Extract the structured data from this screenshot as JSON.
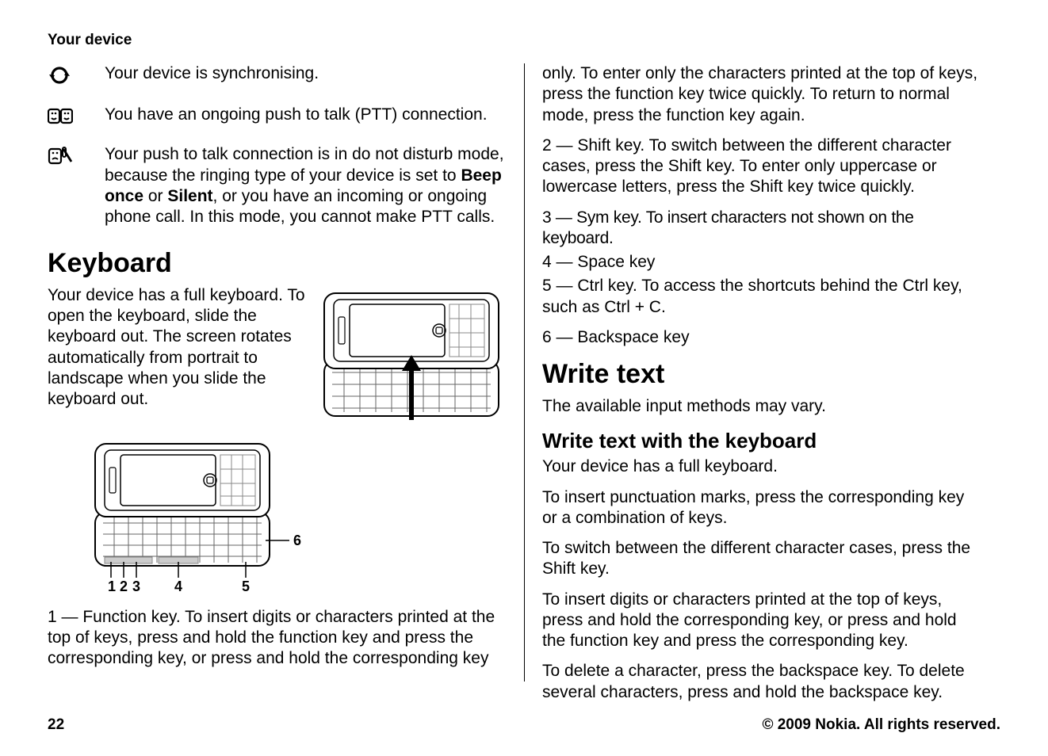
{
  "header": "Your device",
  "icons": [
    {
      "name": "sync-icon",
      "text_key": "icons.0.text",
      "text": "Your device is synchronising."
    },
    {
      "name": "ptt-ongoing-icon",
      "text_key": "icons.1.text",
      "text": "You have an ongoing push to talk (PTT) connection."
    },
    {
      "name": "ptt-dnd-icon",
      "text_key": "icons.2.text",
      "text_pre": "Your push to talk connection is in do not disturb mode, because the ringing type of your device is set to ",
      "bold1": "Beep once",
      "mid": " or ",
      "bold2": "Silent",
      "text_post": ", or you have an incoming or ongoing phone call. In this mode, you cannot make PTT calls."
    }
  ],
  "keyboard": {
    "heading": "Keyboard",
    "open_text": "Your device has a full keyboard. To open the keyboard, slide the keyboard out. The screen rotates automatically from portrait to landscape when you slide the keyboard out.",
    "labels": [
      "1",
      "2",
      "3",
      "4",
      "5",
      "6"
    ],
    "desc_1": "1 — Function key. To insert digits or characters printed at the top of keys, press and hold the function key and press the corresponding key, or press and hold the corresponding key"
  },
  "right": {
    "cont_1": "only. To enter only the characters printed at the top of keys, press the function key twice quickly. To return to normal mode, press the function key again.",
    "desc_2": "2 — Shift key. To switch between the different character cases, press the Shift key. To enter only uppercase or lowercase letters, press the Shift key twice quickly.",
    "desc_3": "3 — Sym key. To insert characters not shown on the keyboard.",
    "desc_4": "4 — Space key",
    "desc_5": "5 — Ctrl key. To access the shortcuts behind the Ctrl key, such as Ctrl + C.",
    "desc_6": "6 — Backspace key",
    "write_heading": "Write text",
    "write_intro": "The available input methods may vary.",
    "write_sub": "Write text with the keyboard",
    "p1": "Your device has a full keyboard.",
    "p2": "To insert punctuation marks, press the corresponding key or a combination of keys.",
    "p3": "To switch between the different character cases, press the Shift key.",
    "p4": "To insert digits or characters printed at the top of keys, press and hold the corresponding key, or press and hold the function key and press the corresponding key.",
    "p5": "To delete a character, press the backspace key. To delete several characters, press and hold the backspace key."
  },
  "footer": {
    "page": "22",
    "copyright": "© 2009 Nokia. All rights reserved."
  }
}
